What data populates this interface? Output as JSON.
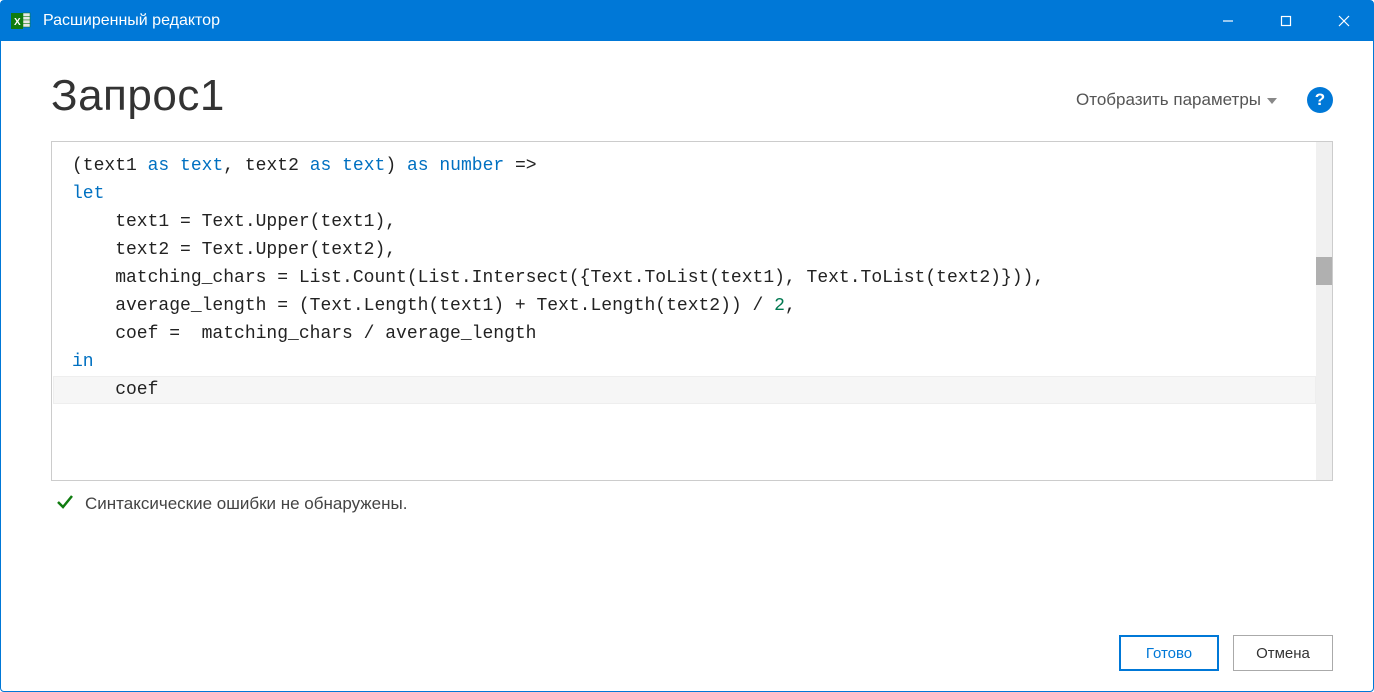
{
  "titlebar": {
    "title": "Расширенный редактор"
  },
  "header": {
    "query_name": "Запрос1",
    "display_options": "Отобразить параметры"
  },
  "code": {
    "line1_pre": "(text1 ",
    "line1_kw1": "as",
    "line1_mid1": " ",
    "line1_kw2": "text",
    "line1_mid2": ", text2 ",
    "line1_kw3": "as",
    "line1_mid3": " ",
    "line1_kw4": "text",
    "line1_mid4": ") ",
    "line1_kw5": "as",
    "line1_mid5": " ",
    "line1_kw6": "number",
    "line1_post": " =>",
    "line2": "let",
    "line3": "    text1 = Text.Upper(text1),",
    "line4": "    text2 = Text.Upper(text2),",
    "line5": "    matching_chars = List.Count(List.Intersect({Text.ToList(text1), Text.ToList(text2)})),",
    "line6_pre": "    average_length = (Text.Length(text1) + Text.Length(text2)) / ",
    "line6_num": "2",
    "line6_post": ",",
    "line7": "    coef =  matching_chars / average_length",
    "line8": "in",
    "line9": "    coef"
  },
  "status": {
    "message": "Синтаксические ошибки не обнаружены."
  },
  "footer": {
    "done": "Готово",
    "cancel": "Отмена"
  }
}
